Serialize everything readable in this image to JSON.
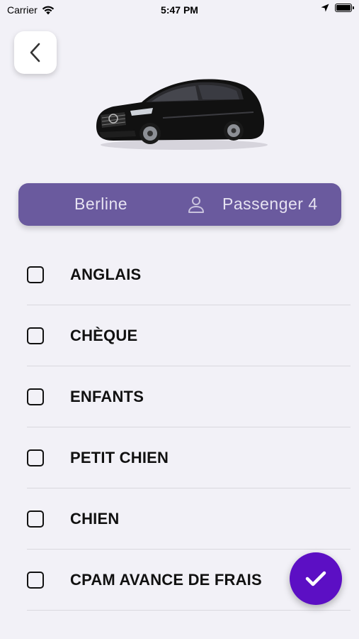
{
  "status_bar": {
    "carrier": "Carrier",
    "time": "5:47 PM",
    "icons": [
      "wifi-icon",
      "location-arrow-icon",
      "battery-icon"
    ],
    "battery_level": 1.0
  },
  "header": {
    "back_icon": "chevron-left-icon"
  },
  "vehicle": {
    "type": "Berline",
    "passenger_icon": "person-icon",
    "passenger_label": "Passenger 4",
    "banner_color": "#6a5a9e"
  },
  "options": [
    {
      "label": "ANGLAIS",
      "checked": false
    },
    {
      "label": "CHÈQUE",
      "checked": false
    },
    {
      "label": "ENFANTS",
      "checked": false
    },
    {
      "label": "PETIT CHIEN",
      "checked": false
    },
    {
      "label": "CHIEN",
      "checked": false
    },
    {
      "label": "CPAM AVANCE DE FRAIS",
      "checked": false
    }
  ],
  "confirm": {
    "icon": "checkmark-icon",
    "color": "#5c0fc4"
  }
}
